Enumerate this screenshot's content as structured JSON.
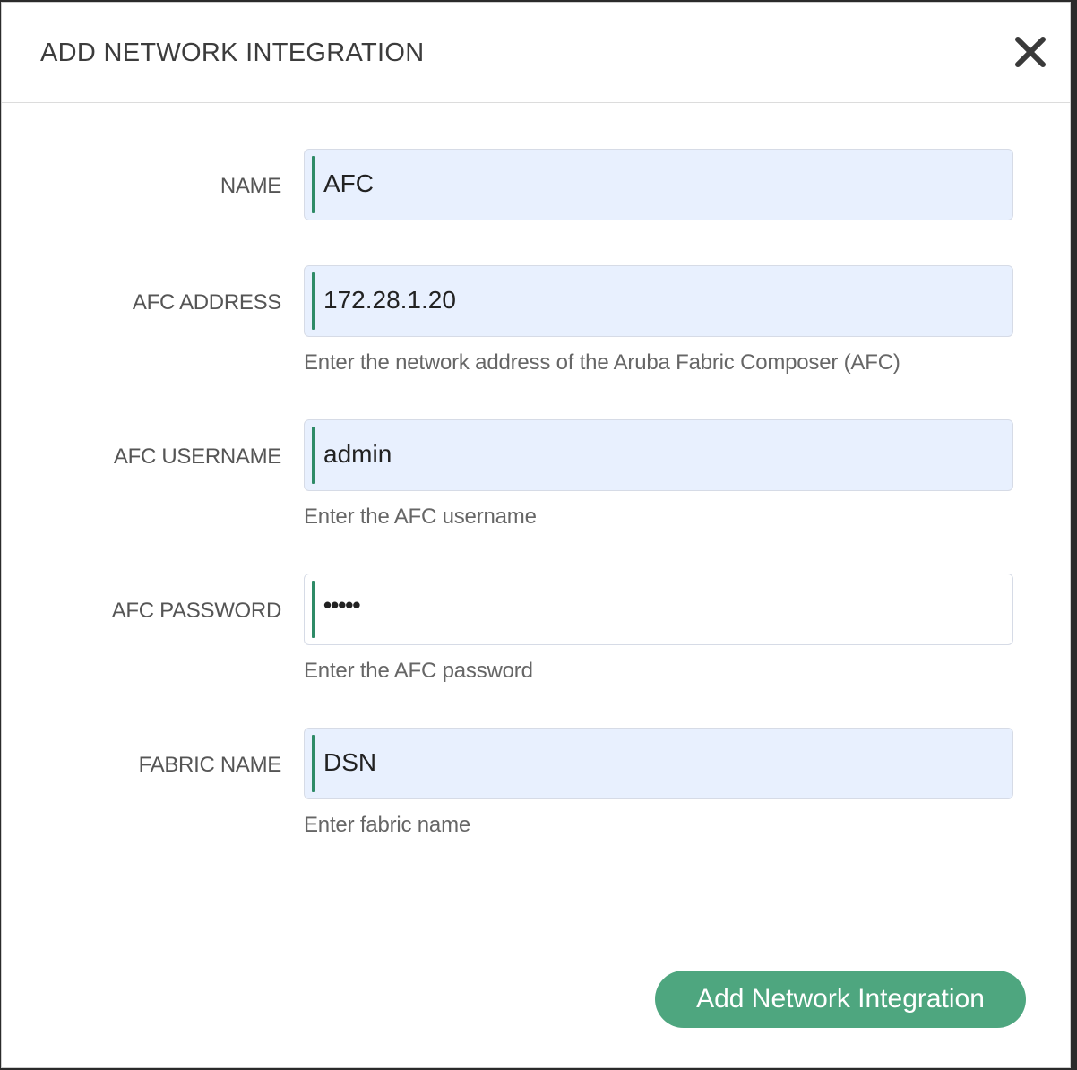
{
  "dialog": {
    "title": "ADD NETWORK INTEGRATION",
    "close_icon": "close-icon"
  },
  "fields": [
    {
      "label": "NAME",
      "value": "AFC",
      "help": ""
    },
    {
      "label": "AFC ADDRESS",
      "value": "172.28.1.20",
      "help": "Enter the network address of the Aruba Fabric Composer (AFC)"
    },
    {
      "label": "AFC USERNAME",
      "value": "admin",
      "help": "Enter the AFC username"
    },
    {
      "label": "AFC PASSWORD",
      "value": "•••••",
      "help": "Enter the AFC password"
    },
    {
      "label": "FABRIC NAME",
      "value": "DSN",
      "help": "Enter fabric name"
    }
  ],
  "submit_label": "Add Network Integration",
  "colors": {
    "accent": "#4ea67f",
    "focus_bar": "#2e8b67",
    "autofill_bg": "#e8f0fe"
  }
}
